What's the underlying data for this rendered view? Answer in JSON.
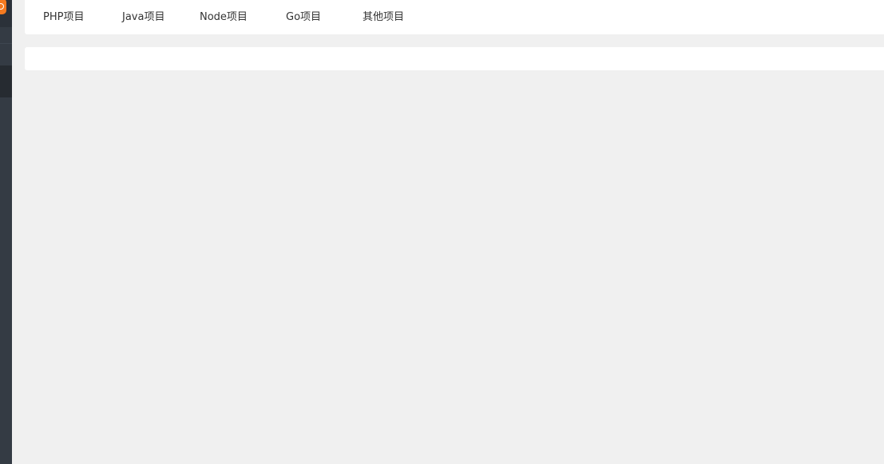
{
  "colors": {
    "sidebar_bg": "#343b44",
    "sidebar_active_bg": "#262b31",
    "logo_accent": "#f47a20",
    "page_bg": "#f0f0f0",
    "panel_bg": "#ffffff",
    "tab_text": "#333333"
  },
  "sidebar": {
    "logo_icon": "app-logo-icon"
  },
  "tabs": [
    {
      "label": "PHP项目"
    },
    {
      "label": "Java项目"
    },
    {
      "label": "Node项目"
    },
    {
      "label": "Go项目"
    },
    {
      "label": "其他项目"
    }
  ]
}
